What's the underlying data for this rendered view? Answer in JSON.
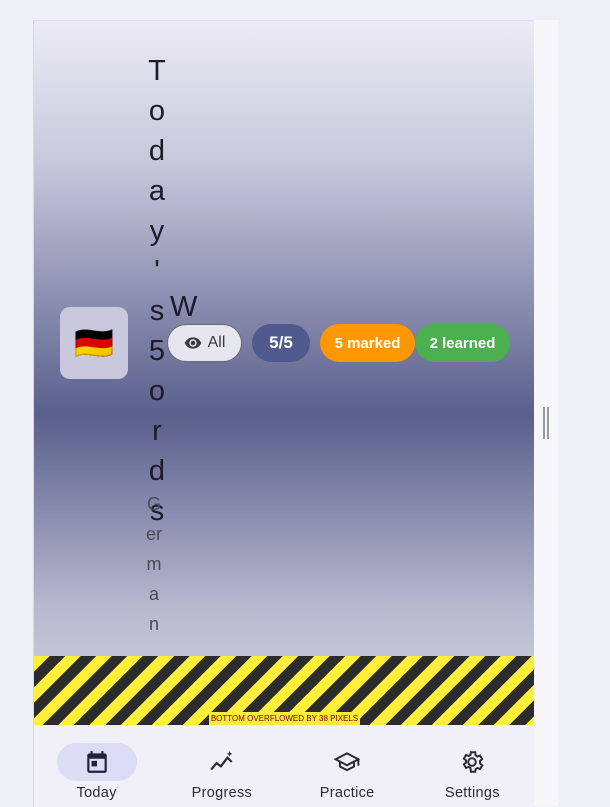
{
  "header": {
    "flag": "🇩🇪",
    "title": "Today's 5 Words",
    "language": "German"
  },
  "chips": {
    "all_label": "All",
    "count": "5/5",
    "marked": "5 marked",
    "learned": "2 learned"
  },
  "overflow_warning": "BOTTOM OVERFLOWED BY 38 PIXELS",
  "nav": {
    "today": "Today",
    "progress": "Progress",
    "practice": "Practice",
    "settings": "Settings"
  },
  "icons": {
    "all": "eye-icon",
    "today": "calendar-icon",
    "progress": "trending-icon",
    "practice": "school-icon",
    "settings": "gear-icon"
  },
  "colors": {
    "count_chip": "#515a8f",
    "marked_chip": "#ff9800",
    "learned_chip": "#4caf50"
  }
}
